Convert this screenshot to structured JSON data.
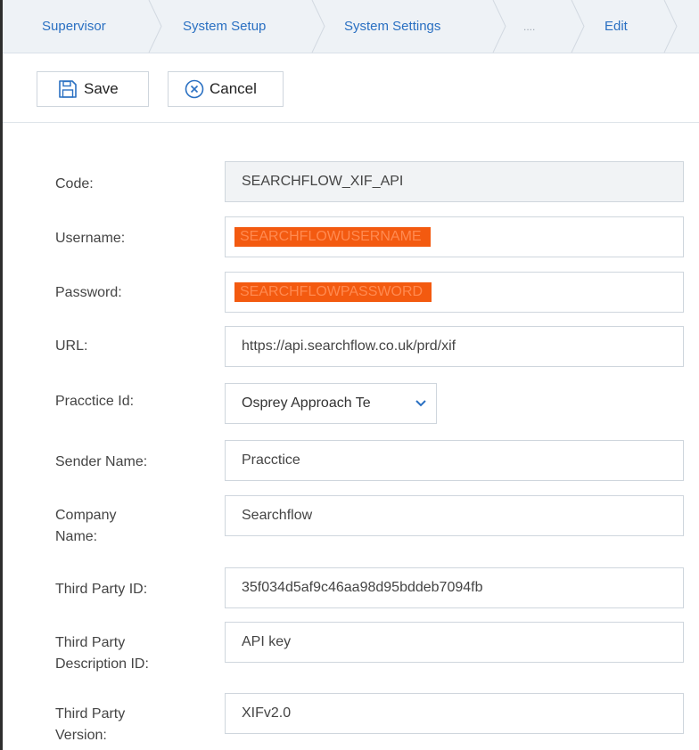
{
  "breadcrumb": {
    "items": [
      "Supervisor",
      "System Setup",
      "System Settings",
      "....",
      "Edit"
    ]
  },
  "toolbar": {
    "save_label": "Save",
    "cancel_label": "Cancel"
  },
  "form": {
    "code": {
      "label": "Code:",
      "value": "SEARCHFLOW_XIF_API"
    },
    "username": {
      "label": "Username:",
      "value": "SEARCHFLOWUSERNAME"
    },
    "password": {
      "label": "Password:",
      "value": "SEARCHFLOWPASSWORD"
    },
    "url": {
      "label": "URL:",
      "value": "https://api.searchflow.co.uk/prd/xif"
    },
    "practice_id": {
      "label": "Pracctice Id:",
      "value": "Osprey Approach Te"
    },
    "sender_name": {
      "label": "Sender Name:",
      "value": "Pracctice"
    },
    "company_name": {
      "label_line1": "Company",
      "label_line2": "Name:",
      "value": "Searchflow"
    },
    "third_party_id": {
      "label": "Third Party ID:",
      "value": "35f034d5af9c46aa98d95bddeb7094fb"
    },
    "third_party_description_id": {
      "label_line1": "Third Party",
      "label_line2": "Description ID:",
      "value": "API key"
    },
    "third_party_version": {
      "label_line1": "Third Party",
      "label_line2": "Version:",
      "value": "XIFv2.0"
    }
  },
  "colors": {
    "link": "#2a70c2",
    "redaction": "#f35a10",
    "breadcrumb_bg": "#eef2f6"
  },
  "icons": [
    "save-icon",
    "cancel-icon",
    "chevron-down-icon"
  ]
}
